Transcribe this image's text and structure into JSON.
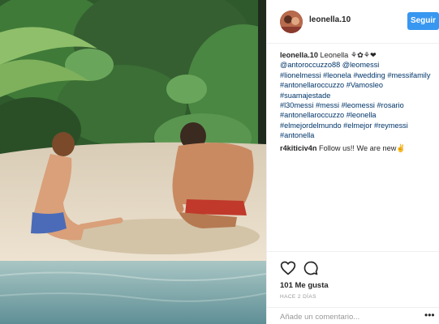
{
  "post": {
    "username": "leonella.10",
    "follow_label": "Seguir",
    "caption": {
      "username": "leonella.10",
      "intro": "Leonella",
      "emojis": "⚘✿⚘❤",
      "lines": [
        [
          "@antoroccuzzo88",
          "@leomessi"
        ],
        [
          "#lionelmessi",
          "#leonela",
          "#wedding",
          "#messifamily"
        ],
        [
          "#antonellaroccuzzo",
          "#Vamosleo"
        ],
        [
          "#suamajestade"
        ],
        [
          "#l30messi",
          "#messi",
          "#leomessi",
          "#rosario"
        ],
        [
          "#antonellaroccuzzo",
          "#leonella"
        ],
        [
          "#elmejordelmundo",
          "#elmejor",
          "#reymessi"
        ],
        [
          "#antonella"
        ]
      ]
    },
    "comments": [
      {
        "username": "r4kiticiv4n",
        "text": "Follow us!! We are new✌️"
      }
    ],
    "likes_text": "101 Me gusta",
    "timestamp": "HACE 2 DÍAS",
    "comment_placeholder": "Añade un comentario...",
    "more_label": "•••"
  },
  "icons": [
    "heart-icon",
    "comment-icon",
    "more-options-icon"
  ],
  "colors": {
    "accent": "#3897f0",
    "hashtag": "#003569",
    "muted": "#999999",
    "border": "#efefef"
  }
}
